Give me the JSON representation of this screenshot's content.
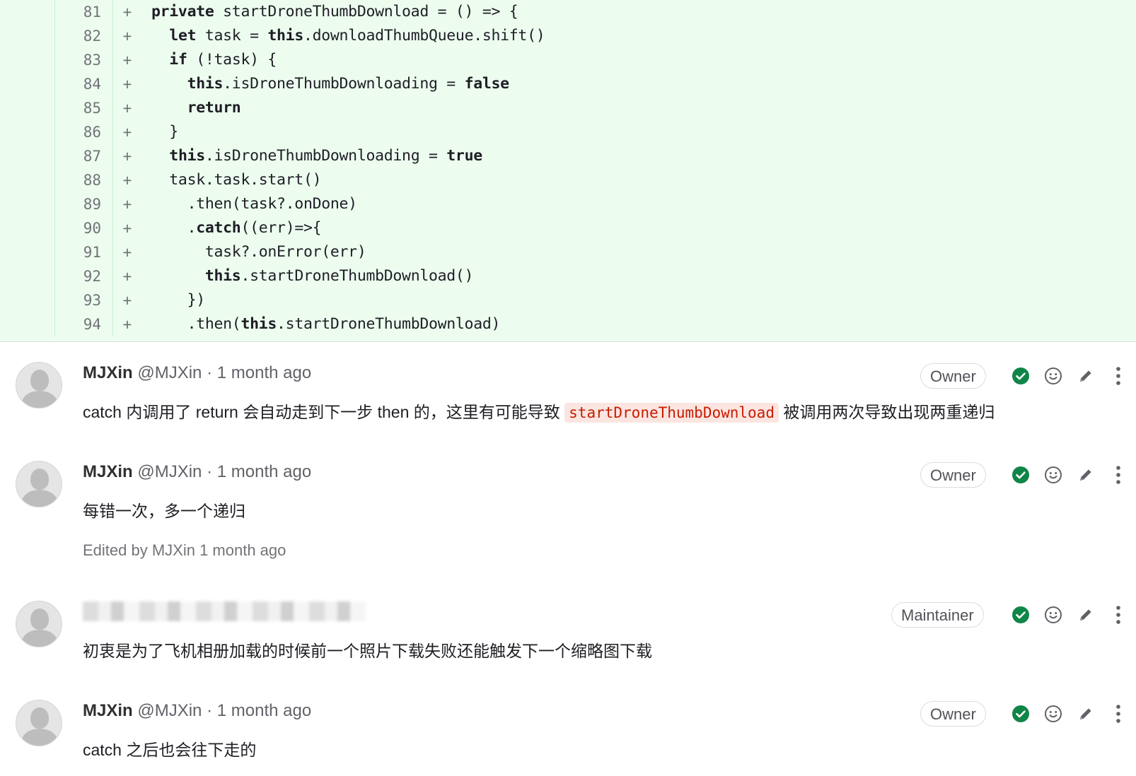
{
  "diff": {
    "lines": [
      {
        "num": "81",
        "sign": "+",
        "html": "<b>private</b> startDroneThumbDownload = () => {"
      },
      {
        "num": "82",
        "sign": "+",
        "html": "  <b>let</b> task = <b>this</b>.downloadThumbQueue.shift()"
      },
      {
        "num": "83",
        "sign": "+",
        "html": "  <b>if</b> (!task) {"
      },
      {
        "num": "84",
        "sign": "+",
        "html": "    <b>this</b>.isDroneThumbDownloading = <b>false</b>"
      },
      {
        "num": "85",
        "sign": "+",
        "html": "    <b>return</b>"
      },
      {
        "num": "86",
        "sign": "+",
        "html": "  }"
      },
      {
        "num": "87",
        "sign": "+",
        "html": "  <b>this</b>.isDroneThumbDownloading = <b>true</b>"
      },
      {
        "num": "88",
        "sign": "+",
        "html": "  task.task.start()"
      },
      {
        "num": "89",
        "sign": "+",
        "html": "    .then(task?.onDone)"
      },
      {
        "num": "90",
        "sign": "+",
        "html": "    .<b>catch</b>((err)=>{"
      },
      {
        "num": "91",
        "sign": "+",
        "html": "      task?.onError(err)"
      },
      {
        "num": "92",
        "sign": "+",
        "html": "      <b>this</b>.startDroneThumbDownload()"
      },
      {
        "num": "93",
        "sign": "+",
        "html": "    })"
      },
      {
        "num": "94",
        "sign": "+",
        "html": "    .then(<b>this</b>.startDroneThumbDownload)"
      }
    ]
  },
  "notes": [
    {
      "author": "MJXin",
      "handle": "@MJXin",
      "time": "· 1 month ago",
      "role": "Owner",
      "body_before": "catch 内调用了 return 会自动走到下一步 then 的，这里有可能导致",
      "body_code": "startDroneThumbDownload",
      "body_after": "被调用两次导致出现两重递归"
    },
    {
      "author": "MJXin",
      "handle": "@MJXin",
      "time": "· 1 month ago",
      "role": "Owner",
      "body": "每错一次，多一个递归",
      "edited": "Edited by MJXin 1 month ago"
    },
    {
      "role": "Maintainer",
      "time": "· 1 month ago",
      "body": "初衷是为了飞机相册加载的时候前一个照片下载失败还能触发下一个缩略图下载"
    },
    {
      "author": "MJXin",
      "handle": "@MJXin",
      "time": "· 1 month ago",
      "role": "Owner",
      "body": "catch 之后也会往下走的"
    }
  ],
  "icons": {
    "resolve": "check-circle-icon",
    "reaction": "smiley-icon",
    "edit": "pencil-icon",
    "more": "kebab-menu-icon"
  },
  "colors": {
    "diff_added_bg": "#ecfdf0",
    "resolve_green": "#108548",
    "inline_code_text": "#c91c00",
    "inline_code_bg": "#fbe5e1"
  }
}
